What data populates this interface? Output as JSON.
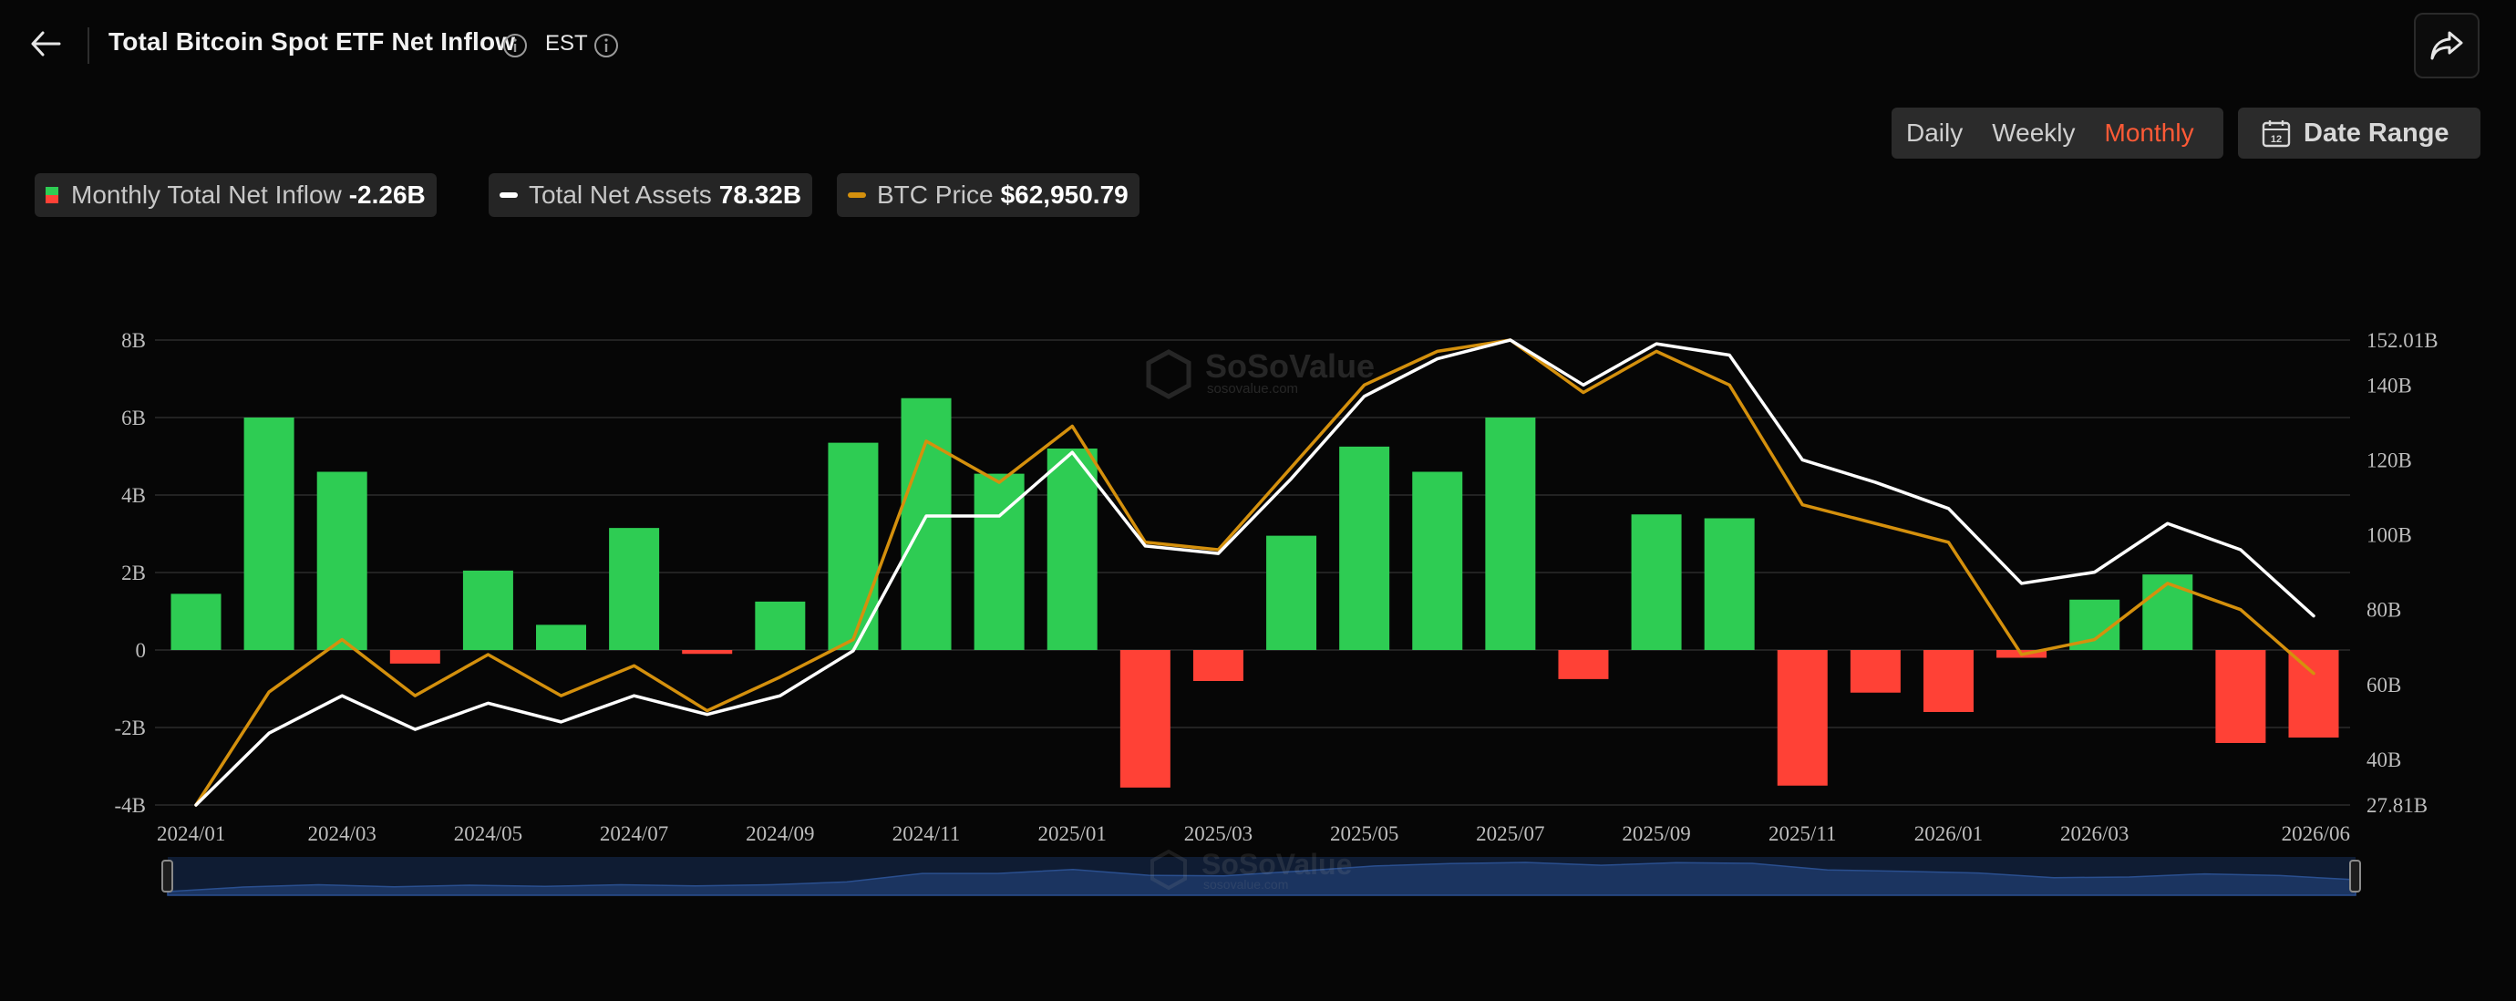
{
  "header": {
    "title": "Total Bitcoin Spot ETF Net Inflow",
    "timezone": "EST"
  },
  "controls": {
    "periods": [
      {
        "label": "Daily",
        "active": false
      },
      {
        "label": "Weekly",
        "active": false
      },
      {
        "label": "Monthly",
        "active": true
      }
    ],
    "date_range_label": "Date Range",
    "date_range_day": "12"
  },
  "legend": {
    "inflow": {
      "label": "Monthly Total Net Inflow",
      "value": "-2.26B"
    },
    "assets": {
      "label": "Total Net Assets",
      "value": "78.32B"
    },
    "btc": {
      "label": "BTC Price",
      "value": "$62,950.79"
    }
  },
  "watermark": {
    "brand": "SoSoValue",
    "url": "sosovalue.com"
  },
  "colors": {
    "positive": "#2ecc53",
    "negative": "#ff4136",
    "assets_line": "#ffffff",
    "btc_line": "#d4900d",
    "active_period": "#ff5a36",
    "navigator_fill": "#1b3460"
  },
  "chart_data": {
    "type": "bar",
    "months": [
      "2024/01",
      "2024/02",
      "2024/03",
      "2024/04",
      "2024/05",
      "2024/06",
      "2024/07",
      "2024/08",
      "2024/09",
      "2024/10",
      "2024/11",
      "2024/12",
      "2025/01",
      "2025/02",
      "2025/03",
      "2025/04",
      "2025/05",
      "2025/06",
      "2025/07",
      "2025/08",
      "2025/09",
      "2025/10",
      "2025/11",
      "2025/12",
      "2026/01",
      "2026/02",
      "2026/03",
      "2026/04",
      "2026/05",
      "2026/06"
    ],
    "x_tick_labels": [
      "2024/01",
      "2024/03",
      "2024/05",
      "2024/07",
      "2024/09",
      "2024/11",
      "2025/01",
      "2025/03",
      "2025/05",
      "2025/07",
      "2025/09",
      "2025/11",
      "2026/01",
      "2026/03",
      "2026/06"
    ],
    "x_tick_months": [
      "2024/01",
      "2024/03",
      "2024/05",
      "2024/07",
      "2024/09",
      "2024/11",
      "2025/01",
      "2025/03",
      "2025/05",
      "2025/07",
      "2025/09",
      "2025/11",
      "2026/01",
      "2026/03",
      "2026/06"
    ],
    "series": [
      {
        "name": "Monthly Total Net Inflow",
        "axis": "left",
        "kind": "bar",
        "values": [
          1.45,
          6.0,
          4.6,
          -0.35,
          2.05,
          0.65,
          3.15,
          -0.1,
          1.25,
          5.35,
          6.5,
          4.55,
          5.2,
          -3.55,
          -0.8,
          2.95,
          5.25,
          4.6,
          6.0,
          -0.75,
          3.5,
          3.4,
          -3.5,
          -1.1,
          -1.6,
          -0.2,
          1.3,
          1.95,
          -2.4,
          -2.26
        ]
      },
      {
        "name": "Total Net Assets",
        "axis": "right",
        "kind": "line",
        "values": [
          27.81,
          47,
          57,
          48,
          55,
          50,
          57,
          52,
          57,
          69,
          105,
          105,
          122,
          97,
          95,
          115,
          137,
          147,
          152.01,
          140,
          151,
          148,
          120,
          114,
          107,
          87,
          90,
          103,
          96,
          78.32
        ]
      },
      {
        "name": "BTC Price",
        "axis": "right",
        "kind": "line",
        "values": [
          27.81,
          58,
          72,
          57,
          68,
          57,
          65,
          53,
          62,
          72,
          125,
          114,
          129,
          98,
          96,
          118,
          140,
          149,
          152.01,
          138,
          149,
          140,
          108,
          103,
          98,
          68,
          72,
          87,
          80,
          62.95
        ]
      }
    ],
    "y_left": {
      "ticks": [
        "-4B",
        "-2B",
        "0",
        "2B",
        "4B",
        "6B",
        "8B"
      ],
      "tick_values": [
        -4,
        -2,
        0,
        2,
        4,
        6,
        8
      ],
      "range": [
        -4,
        8
      ]
    },
    "y_right": {
      "ticks": [
        "27.81B",
        "40B",
        "60B",
        "80B",
        "100B",
        "120B",
        "140B",
        "152.01B"
      ],
      "tick_values": [
        27.81,
        40,
        60,
        80,
        100,
        120,
        140,
        152.01
      ],
      "range": [
        27.81,
        152.01
      ]
    },
    "grid": true,
    "legend_position": "top-left"
  }
}
